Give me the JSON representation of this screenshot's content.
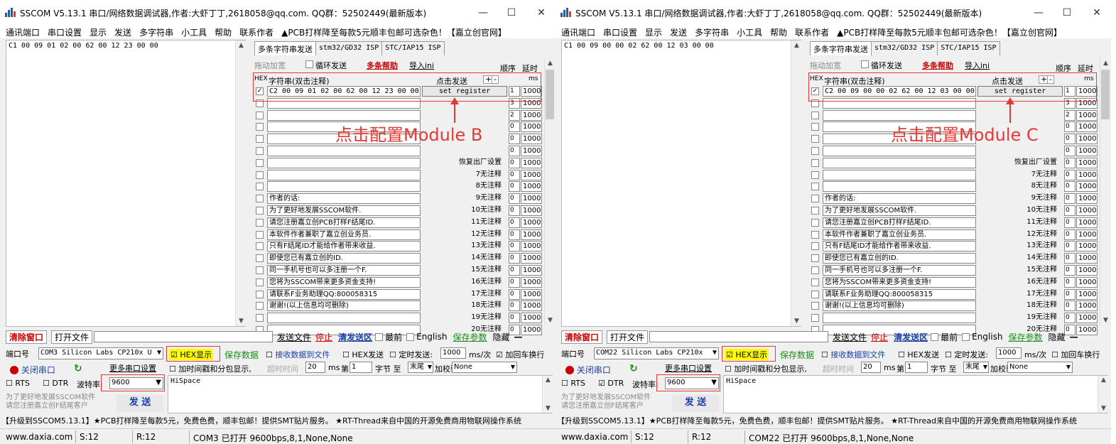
{
  "colors": {
    "annotation": "#e53935",
    "hex_bg": "#ffff00",
    "accent_blue": "#1a3fa8",
    "accent_green": "#1b8a1b",
    "close_red": "#c00000"
  },
  "windows": [
    {
      "title": "SSCOM V5.13.1 串口/网络数据调试器,作者:大虾丁丁,2618058@qq.com. QQ群：52502449(最新版本)",
      "menu": [
        "通讯端口",
        "串口设置",
        "显示",
        "发送",
        "多字符串",
        "小工具",
        "帮助",
        "联系作者",
        "▲PCB打样降至每款5元顺丰包邮可选杂色！【嘉立创官网】"
      ],
      "receive_text": "C1 00 09 01 02 00 62 00 12 23 00 00",
      "tabs": [
        "多条字符串发送",
        "stm32/GD32 ISP",
        "STC/IAP15 ISP"
      ],
      "toprow": {
        "drag": "拖动加宽",
        "loop": "循环发送",
        "help": "多条帮助",
        "import": "导入ini",
        "order": "顺序",
        "delay": "延时"
      },
      "header": {
        "hex": "HEX",
        "string": "字符串(双击注释)",
        "click_send": "点击发送",
        "plus": "+",
        "minus": "-",
        "ms": "ms"
      },
      "rows": [
        {
          "checked": true,
          "text": "C2 00 09 01 02 00 62 00 12 23 00 00",
          "button": "set register",
          "order": "1",
          "delay": "1000"
        },
        {
          "checked": false,
          "text": "",
          "button": "",
          "order": "3",
          "delay": "1000"
        },
        {
          "checked": false,
          "text": "",
          "button": "",
          "order": "2",
          "delay": "1000"
        },
        {
          "checked": false,
          "text": "",
          "button": "",
          "order": "0",
          "delay": "1000"
        },
        {
          "checked": false,
          "text": "",
          "button": "",
          "order": "0",
          "delay": "1000"
        },
        {
          "checked": false,
          "text": "",
          "button": "",
          "order": "0",
          "delay": "1000"
        },
        {
          "checked": false,
          "text": "",
          "button": "恢复出厂设置",
          "order": "0",
          "delay": "1000"
        },
        {
          "checked": false,
          "text": "",
          "button": "7无注释",
          "order": "0",
          "delay": "1000"
        },
        {
          "checked": false,
          "text": "",
          "button": "8无注释",
          "order": "0",
          "delay": "1000"
        },
        {
          "checked": false,
          "text": "作者的话:",
          "button": "9无注释",
          "order": "0",
          "delay": "1000"
        },
        {
          "checked": false,
          "text": "为了更好地发展SSCOM软件.",
          "button": "10无注释",
          "order": "0",
          "delay": "1000"
        },
        {
          "checked": false,
          "text": "请您注册嘉立创PCB打样F结尾ID.",
          "button": "11无注释",
          "order": "0",
          "delay": "1000"
        },
        {
          "checked": false,
          "text": "本软件作者兼职了嘉立创业务员.",
          "button": "12无注释",
          "order": "0",
          "delay": "1000"
        },
        {
          "checked": false,
          "text": "只有F结尾ID才能给作者带来收益.",
          "button": "13无注释",
          "order": "0",
          "delay": "1000"
        },
        {
          "checked": false,
          "text": "即使您已有嘉立创的ID.",
          "button": "14无注释",
          "order": "0",
          "delay": "1000"
        },
        {
          "checked": false,
          "text": "同一手机号也可以多注册一个F.",
          "button": "15无注释",
          "order": "0",
          "delay": "1000"
        },
        {
          "checked": false,
          "text": "您将为SSCOM带来更多资金支持!",
          "button": "16无注释",
          "order": "0",
          "delay": "1000"
        },
        {
          "checked": false,
          "text": "请联系F业务助理QQ:800058315",
          "button": "17无注释",
          "order": "0",
          "delay": "1000"
        },
        {
          "checked": false,
          "text": "谢谢!(以上信息均可删除)",
          "button": "18无注释",
          "order": "0",
          "delay": "1000"
        },
        {
          "checked": false,
          "text": "",
          "button": "19无注释",
          "order": "0",
          "delay": "1000"
        },
        {
          "checked": false,
          "text": "",
          "button": "20无注释",
          "order": "0",
          "delay": "1000"
        }
      ],
      "annotation": "点击配置Module B",
      "bottom": {
        "clear": "清除窗口",
        "open_file": "打开文件",
        "send_file": "发送文件",
        "stop": "停止",
        "clear_send": "清发送区",
        "topmost": "最前",
        "english": "English",
        "save_params": "保存参数",
        "hide": "隐藏",
        "minus": "—",
        "port_label": "端口号",
        "port_value": "COM3 Silicon Labs CP210x U",
        "hex_display": "HEX显示",
        "save_data": "保存数据",
        "recv_to_file": "接收数据到文件",
        "hex_send": "HEX发送",
        "timed_send": "定时发送:",
        "interval": "1000",
        "interval_unit": "ms/次",
        "add_crlf": "加回车换行",
        "add_crlf_checked": true,
        "close_port": "关闭串口",
        "more_settings": "更多串口设置",
        "timestamp": "加时间戳和分包显示,",
        "timeout_label": "超时时间",
        "timeout": "20",
        "ms": "ms",
        "byte_label": "第",
        "byte_num": "1",
        "byte_unit": "字节 至",
        "end": "末尾",
        "checksum_label": "加校验",
        "checksum": "None",
        "rts": "RTS",
        "dtr": "DTR",
        "dtr_checked": false,
        "baud_label": "波特率:",
        "baud": "9600",
        "send_text": "HiSpace",
        "promo1": "为了更好地发展SSCOM软件",
        "promo2": "请您注册嘉立创F结尾客户",
        "send": "发 送"
      },
      "adbar": "【升级到SSCOM5.13.1】★PCB打样降至每款5元，免费色费，顺丰包邮！提供SMT贴片服务。 ★RT-Thread来自中国的开源免费商用物联网操作系统",
      "status": {
        "site": "www.daxia.com",
        "s": "S:12",
        "r": "R:12",
        "port": "COM3 已打开  9600bps,8,1,None,None"
      }
    },
    {
      "title": "SSCOM V5.13.1 串口/网络数据调试器,作者:大虾丁丁,2618058@qq.com. QQ群：52502449(最新版本)",
      "menu": [
        "通讯端口",
        "串口设置",
        "显示",
        "发送",
        "多字符串",
        "小工具",
        "帮助",
        "联系作者",
        "▲PCB打样降至每款5元顺丰包邮可选杂色！【嘉立创官网】"
      ],
      "receive_text": "C1 00 09 00 00 02 62 00 12 03 00 00",
      "tabs": [
        "多条字符串发送",
        "stm32/GD32 ISP",
        "STC/IAP15 ISP"
      ],
      "toprow": {
        "drag": "拖动加宽",
        "loop": "循环发送",
        "help": "多条帮助",
        "import": "导入ini",
        "order": "顺序",
        "delay": "延时"
      },
      "header": {
        "hex": "HEX",
        "string": "字符串(双击注释)",
        "click_send": "点击发送",
        "plus": "+",
        "minus": "-",
        "ms": "ms"
      },
      "rows": [
        {
          "checked": true,
          "text": "C2 00 09 00 00 02 62 00 12 03 00 00",
          "button": "set register",
          "order": "1",
          "delay": "1000"
        },
        {
          "checked": false,
          "text": "",
          "button": "",
          "order": "3",
          "delay": "1000"
        },
        {
          "checked": false,
          "text": "",
          "button": "",
          "order": "2",
          "delay": "1000"
        },
        {
          "checked": false,
          "text": "",
          "button": "",
          "order": "0",
          "delay": "1000"
        },
        {
          "checked": false,
          "text": "",
          "button": "",
          "order": "0",
          "delay": "1000"
        },
        {
          "checked": false,
          "text": "",
          "button": "",
          "order": "0",
          "delay": "1000"
        },
        {
          "checked": false,
          "text": "",
          "button": "恢复出厂设置",
          "order": "0",
          "delay": "1000"
        },
        {
          "checked": false,
          "text": "",
          "button": "7无注释",
          "order": "0",
          "delay": "1000"
        },
        {
          "checked": false,
          "text": "",
          "button": "8无注释",
          "order": "0",
          "delay": "1000"
        },
        {
          "checked": false,
          "text": "作者的话:",
          "button": "9无注释",
          "order": "0",
          "delay": "1000"
        },
        {
          "checked": false,
          "text": "为了更好地发展SSCOM软件.",
          "button": "10无注释",
          "order": "0",
          "delay": "1000"
        },
        {
          "checked": false,
          "text": "请您注册嘉立创PCB打样F结尾ID.",
          "button": "11无注释",
          "order": "0",
          "delay": "1000"
        },
        {
          "checked": false,
          "text": "本软件作者兼职了嘉立创业务员.",
          "button": "12无注释",
          "order": "0",
          "delay": "1000"
        },
        {
          "checked": false,
          "text": "只有F结尾ID才能给作者带来收益.",
          "button": "13无注释",
          "order": "0",
          "delay": "1000"
        },
        {
          "checked": false,
          "text": "即使您已有嘉立创的ID.",
          "button": "14无注释",
          "order": "0",
          "delay": "1000"
        },
        {
          "checked": false,
          "text": "同一手机号也可以多注册一个F.",
          "button": "15无注释",
          "order": "0",
          "delay": "1000"
        },
        {
          "checked": false,
          "text": "您将为SSCOM带来更多资金支持!",
          "button": "16无注释",
          "order": "0",
          "delay": "1000"
        },
        {
          "checked": false,
          "text": "请联系F业务助理QQ:800058315",
          "button": "17无注释",
          "order": "0",
          "delay": "1000"
        },
        {
          "checked": false,
          "text": "谢谢!(以上信息均可删除)",
          "button": "18无注释",
          "order": "0",
          "delay": "1000"
        },
        {
          "checked": false,
          "text": "",
          "button": "19无注释",
          "order": "0",
          "delay": "1000"
        },
        {
          "checked": false,
          "text": "",
          "button": "20无注释",
          "order": "0",
          "delay": "1000"
        }
      ],
      "annotation": "点击配置Module C",
      "bottom": {
        "clear": "清除窗口",
        "open_file": "打开文件",
        "send_file": "发送文件",
        "stop": "停止",
        "clear_send": "清发送区",
        "topmost": "最前",
        "english": "English",
        "save_params": "保存参数",
        "hide": "隐藏",
        "minus": "—",
        "port_label": "端口号",
        "port_value": "COM22 Silicon Labs CP210x",
        "hex_display": "HEX显示",
        "save_data": "保存数据",
        "recv_to_file": "接收数据到文件",
        "hex_send": "HEX发送",
        "timed_send": "定时发送:",
        "interval": "1000",
        "interval_unit": "ms/次",
        "add_crlf": "加回车换行",
        "add_crlf_checked": false,
        "close_port": "关闭串口",
        "more_settings": "更多串口设置",
        "timestamp": "加时间戳和分包显示,",
        "timeout_label": "超时时间",
        "timeout": "20",
        "ms": "ms",
        "byte_label": "第",
        "byte_num": "1",
        "byte_unit": "字节 至",
        "end": "末尾",
        "checksum_label": "加校验",
        "checksum": "None",
        "rts": "RTS",
        "dtr": "DTR",
        "dtr_checked": true,
        "baud_label": "波特率:",
        "baud": "9600",
        "send_text": "HiSpace",
        "promo1": "为了更好地发展SSCOM软件",
        "promo2": "请您注册嘉立创F结尾客户",
        "send": "发 送"
      },
      "adbar": "【升级到SSCOM5.13.1】★PCB打样降至每款5元，免费色费，顺丰包邮！提供SMT贴片服务。 ★RT-Thread来自中国的开源免费商用物联网操作系统",
      "status": {
        "site": "www.daxia.com",
        "s": "S:12",
        "r": "R:12",
        "port": "COM22 已打开  9600bps,8,1,None,None"
      }
    }
  ]
}
